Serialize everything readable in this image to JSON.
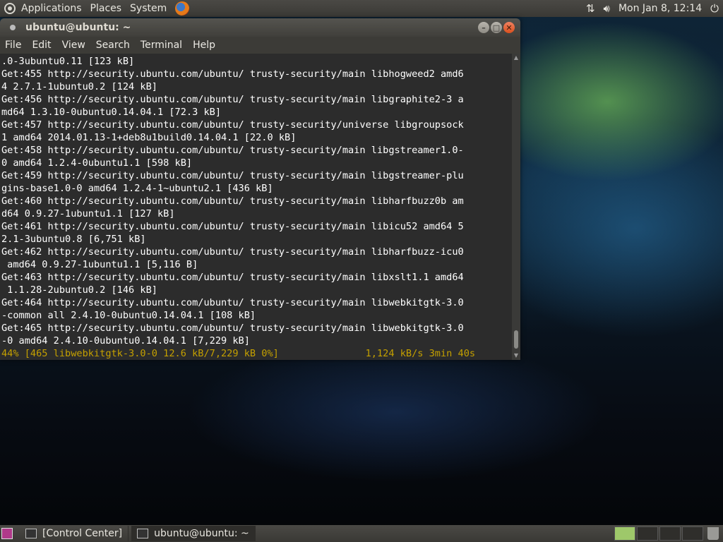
{
  "top_panel": {
    "menus": [
      "Applications",
      "Places",
      "System"
    ],
    "clock": "Mon Jan 8, 12:14"
  },
  "terminal": {
    "title": "ubuntu@ubuntu: ~",
    "menu": [
      "File",
      "Edit",
      "View",
      "Search",
      "Terminal",
      "Help"
    ],
    "lines": [
      ".0-3ubuntu0.11 [123 kB]",
      "Get:455 http://security.ubuntu.com/ubuntu/ trusty-security/main libhogweed2 amd6",
      "4 2.7.1-1ubuntu0.2 [124 kB]",
      "Get:456 http://security.ubuntu.com/ubuntu/ trusty-security/main libgraphite2-3 a",
      "md64 1.3.10-0ubuntu0.14.04.1 [72.3 kB]",
      "Get:457 http://security.ubuntu.com/ubuntu/ trusty-security/universe libgroupsock",
      "1 amd64 2014.01.13-1+deb8u1build0.14.04.1 [22.0 kB]",
      "Get:458 http://security.ubuntu.com/ubuntu/ trusty-security/main libgstreamer1.0-",
      "0 amd64 1.2.4-0ubuntu1.1 [598 kB]",
      "Get:459 http://security.ubuntu.com/ubuntu/ trusty-security/main libgstreamer-plu",
      "gins-base1.0-0 amd64 1.2.4-1~ubuntu2.1 [436 kB]",
      "Get:460 http://security.ubuntu.com/ubuntu/ trusty-security/main libharfbuzz0b am",
      "d64 0.9.27-1ubuntu1.1 [127 kB]",
      "Get:461 http://security.ubuntu.com/ubuntu/ trusty-security/main libicu52 amd64 5",
      "2.1-3ubuntu0.8 [6,751 kB]",
      "Get:462 http://security.ubuntu.com/ubuntu/ trusty-security/main libharfbuzz-icu0",
      " amd64 0.9.27-1ubuntu1.1 [5,116 B]",
      "Get:463 http://security.ubuntu.com/ubuntu/ trusty-security/main libxslt1.1 amd64",
      " 1.1.28-2ubuntu0.2 [146 kB]",
      "Get:464 http://security.ubuntu.com/ubuntu/ trusty-security/main libwebkitgtk-3.0",
      "-common all 2.4.10-0ubuntu0.14.04.1 [108 kB]",
      "Get:465 http://security.ubuntu.com/ubuntu/ trusty-security/main libwebkitgtk-3.0",
      "-0 amd64 2.4.10-0ubuntu0.14.04.1 [7,229 kB]"
    ],
    "status_line": "44% [465 libwebkitgtk-3.0-0 12.6 kB/7,229 kB 0%]               1,124 kB/s 3min 40s"
  },
  "bottom_panel": {
    "tasks": [
      "[Control Center]",
      "ubuntu@ubuntu: ~"
    ]
  },
  "colors": {
    "terminal_bg": "#2c2c2c",
    "status_text": "#c4a000"
  }
}
